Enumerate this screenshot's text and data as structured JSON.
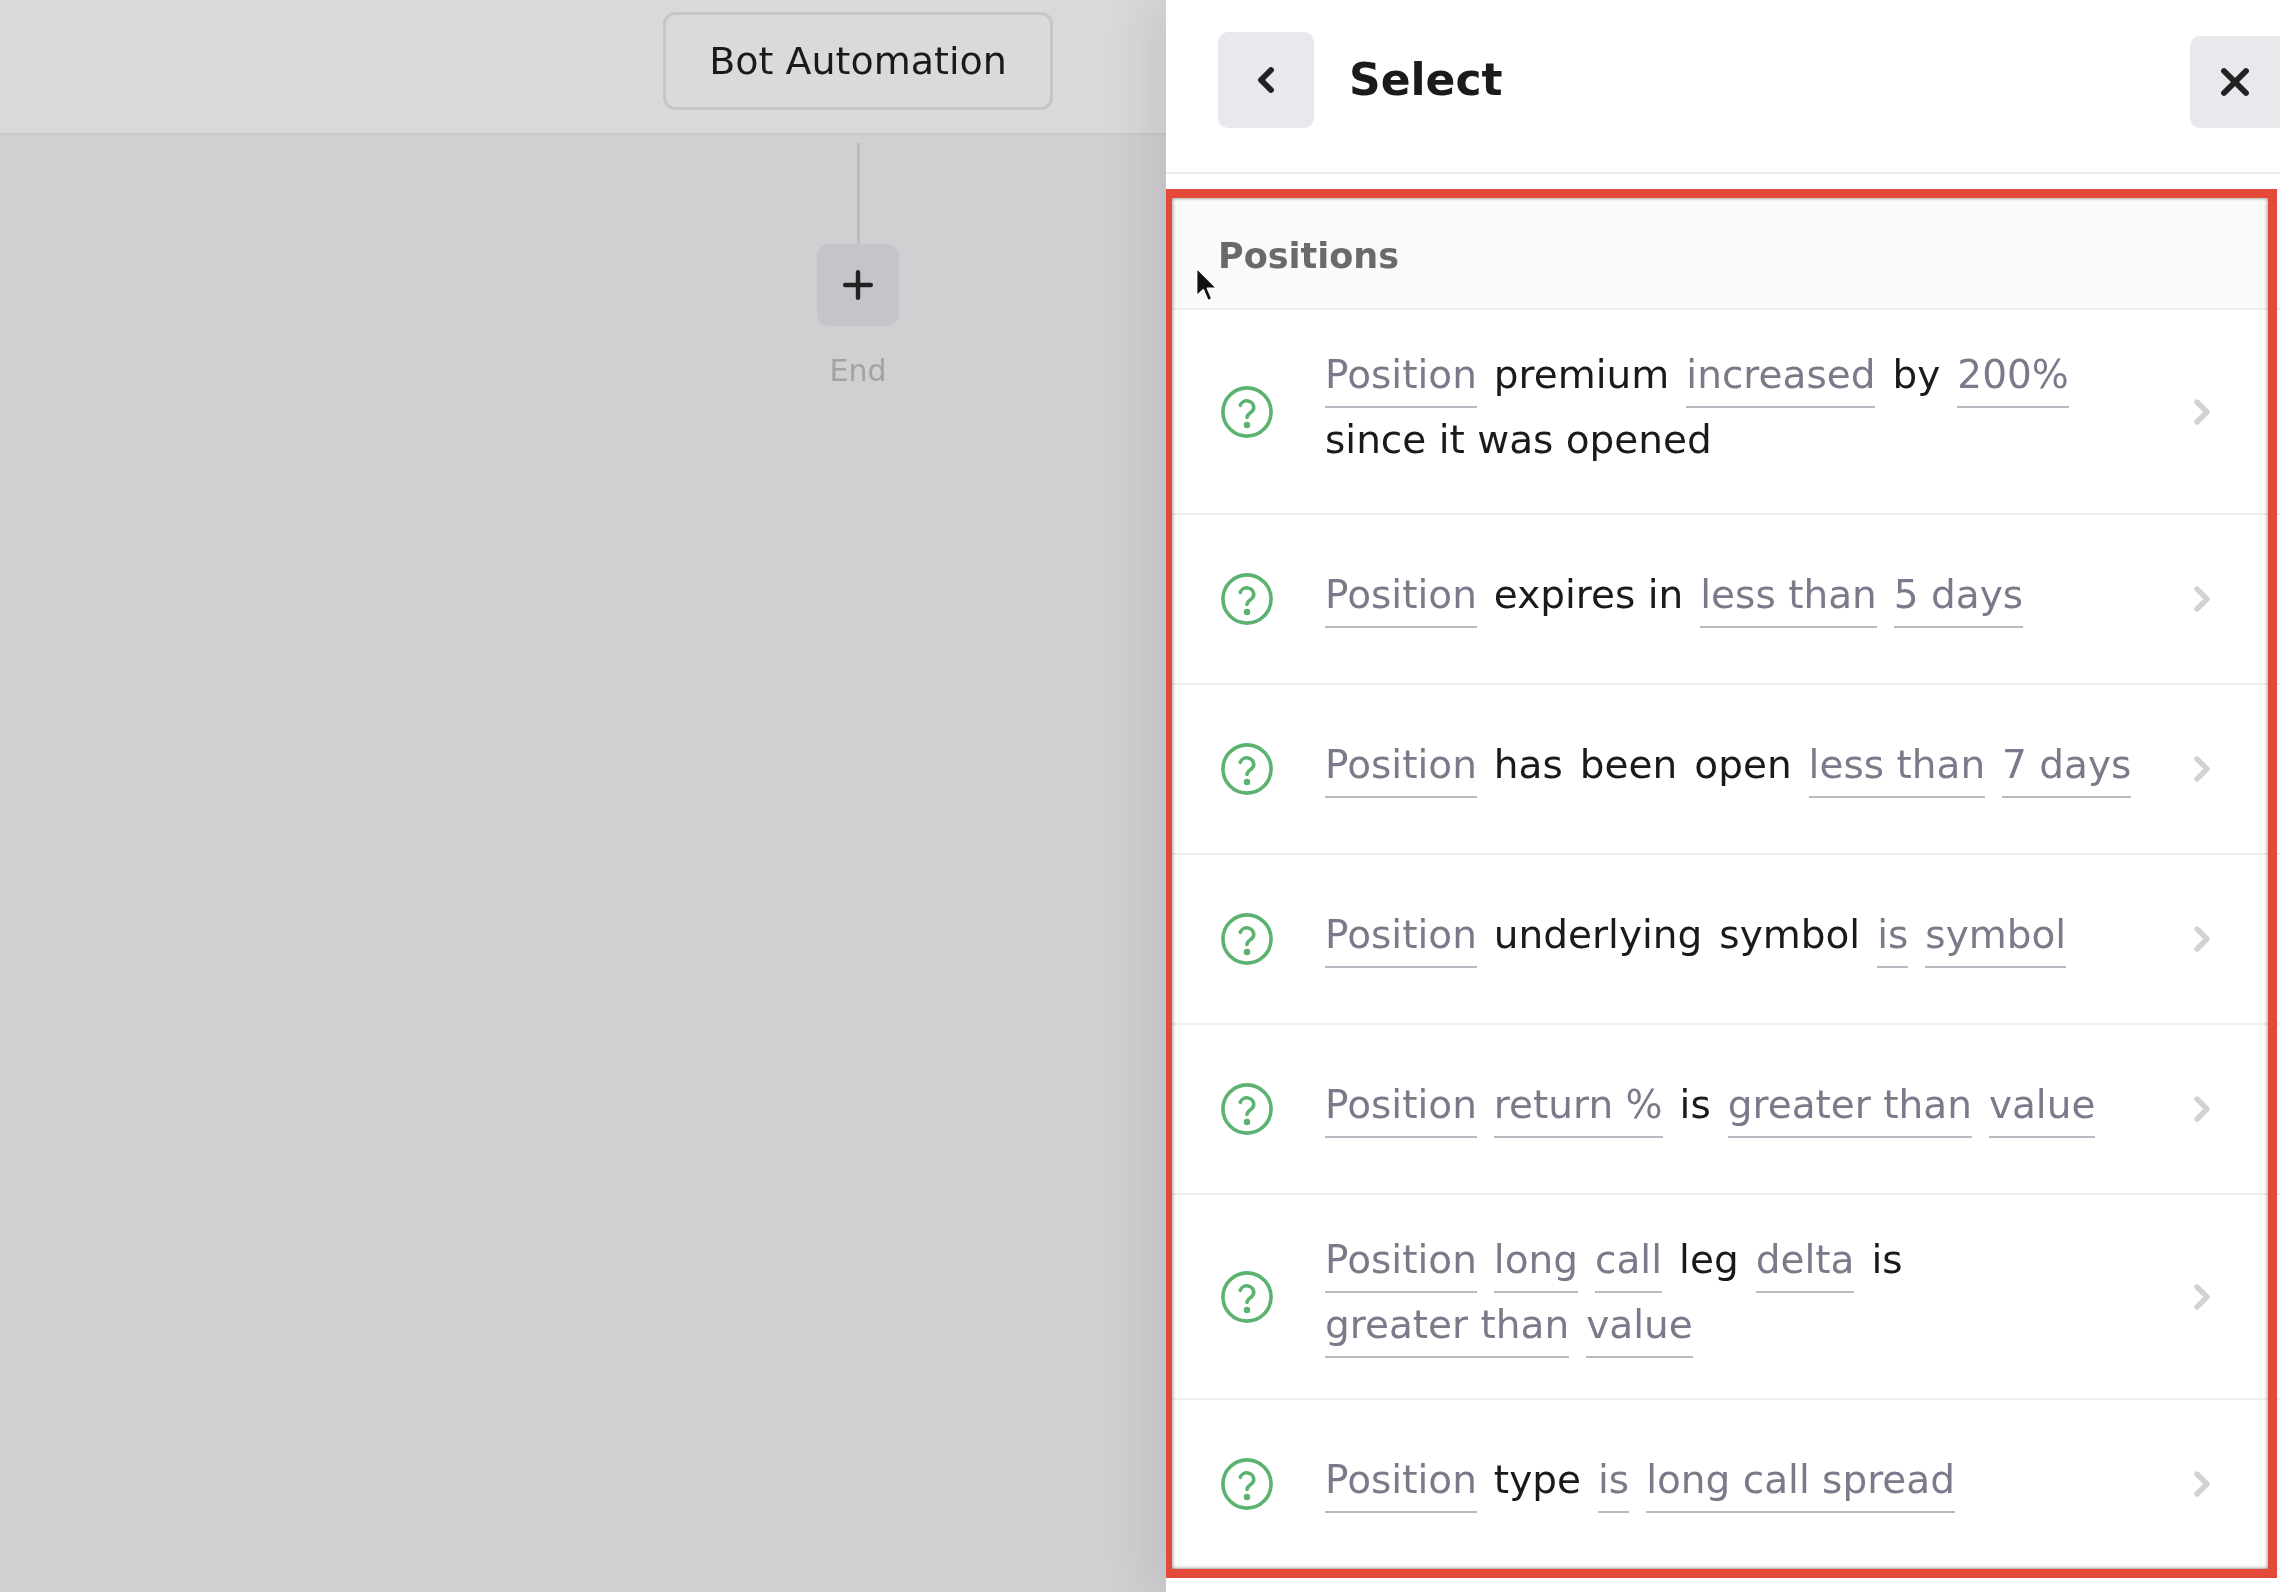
{
  "canvas": {
    "node": {
      "title": "Bot Automation"
    },
    "end_label": "End"
  },
  "panel": {
    "title": "Select",
    "section": {
      "title": "Positions",
      "rows": [
        {
          "tokens": [
            {
              "text": "Position",
              "kind": "field"
            },
            {
              "text": "premium",
              "kind": "text"
            },
            {
              "text": "increased",
              "kind": "field"
            },
            {
              "text": "by",
              "kind": "text"
            },
            {
              "text": "200%",
              "kind": "field"
            },
            {
              "text": "since it was opened",
              "kind": "text"
            }
          ]
        },
        {
          "tokens": [
            {
              "text": "Position",
              "kind": "field"
            },
            {
              "text": "expires in",
              "kind": "text"
            },
            {
              "text": "less than",
              "kind": "field"
            },
            {
              "text": "5 days",
              "kind": "field"
            }
          ]
        },
        {
          "tokens": [
            {
              "text": "Position",
              "kind": "field"
            },
            {
              "text": "has",
              "kind": "text"
            },
            {
              "text": "been",
              "kind": "text"
            },
            {
              "text": "open",
              "kind": "text"
            },
            {
              "text": "less than",
              "kind": "field"
            },
            {
              "text": "7 days",
              "kind": "field"
            }
          ]
        },
        {
          "tokens": [
            {
              "text": "Position",
              "kind": "field"
            },
            {
              "text": "underlying",
              "kind": "text"
            },
            {
              "text": "symbol",
              "kind": "text"
            },
            {
              "text": "is",
              "kind": "field"
            },
            {
              "text": "symbol",
              "kind": "field"
            }
          ]
        },
        {
          "tokens": [
            {
              "text": "Position",
              "kind": "field"
            },
            {
              "text": "return %",
              "kind": "field"
            },
            {
              "text": "is",
              "kind": "text"
            },
            {
              "text": "greater than",
              "kind": "field"
            },
            {
              "text": "value",
              "kind": "field"
            }
          ]
        },
        {
          "tokens": [
            {
              "text": "Position",
              "kind": "field"
            },
            {
              "text": "long",
              "kind": "field"
            },
            {
              "text": "call",
              "kind": "field"
            },
            {
              "text": "leg",
              "kind": "text"
            },
            {
              "text": "delta",
              "kind": "field"
            },
            {
              "text": "is",
              "kind": "text"
            },
            {
              "text": "greater than",
              "kind": "field"
            },
            {
              "text": "value",
              "kind": "field"
            }
          ]
        },
        {
          "tokens": [
            {
              "text": "Position",
              "kind": "field"
            },
            {
              "text": "type",
              "kind": "text"
            },
            {
              "text": "is",
              "kind": "field"
            },
            {
              "text": "long call spread",
              "kind": "field"
            }
          ]
        }
      ]
    }
  }
}
